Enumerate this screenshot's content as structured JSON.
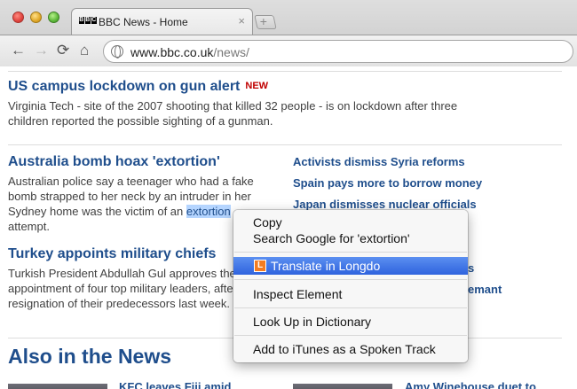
{
  "browser": {
    "tab": {
      "title": "BBC News - Home",
      "favicon": "bbc-logo-icon",
      "close": "×"
    },
    "new_tab": "+",
    "nav": {
      "back": "←",
      "forward": "→",
      "reload": "⟳",
      "home": "⌂"
    },
    "address": {
      "host": "www.bbc.co.uk",
      "path": "/news/"
    }
  },
  "stories": [
    {
      "headline": "US campus lockdown on gun alert",
      "badge": "NEW",
      "summary_lines": [
        "Virginia Tech - site of the 2007 shooting that killed 32 people - is on lockdown after three",
        "children reported the possible sighting of a gunman."
      ]
    },
    {
      "headline": "Australia bomb hoax 'extortion'",
      "summary_lines": [
        "Australian police say a teenager who had a fake",
        "bomb strapped to her neck by an intruder in her",
        "Sydney home was the victim of an ",
        "extortion",
        "attempt."
      ]
    },
    {
      "headline": "Turkey appoints military chiefs",
      "summary_lines": [
        "Turkish President Abdullah Gul approves the",
        "appointment of four top military leaders, afte",
        "resignation of their predecessors last week."
      ]
    }
  ],
  "side_links": [
    "Activists dismiss Syria reforms",
    "Spain pays more to borrow money",
    "Japan dismisses nuclear officials",
    "s",
    "emant"
  ],
  "section": {
    "title": "Also in the News"
  },
  "bottom_links": [
    "KFC leaves Fiji amid",
    "Amy Winehouse duet to"
  ],
  "context_menu": {
    "items": [
      "Copy",
      "Search Google for 'extortion'",
      "Translate in Longdo",
      "Inspect Element",
      "Look Up in Dictionary",
      "Add to iTunes as a Spoken Track"
    ],
    "longdo_icon_letter": "L"
  },
  "colors": {
    "link": "#1f4e8c",
    "badge": "#c00000",
    "selection": "#b5d5ff",
    "menu_highlight": "#2f63de"
  }
}
